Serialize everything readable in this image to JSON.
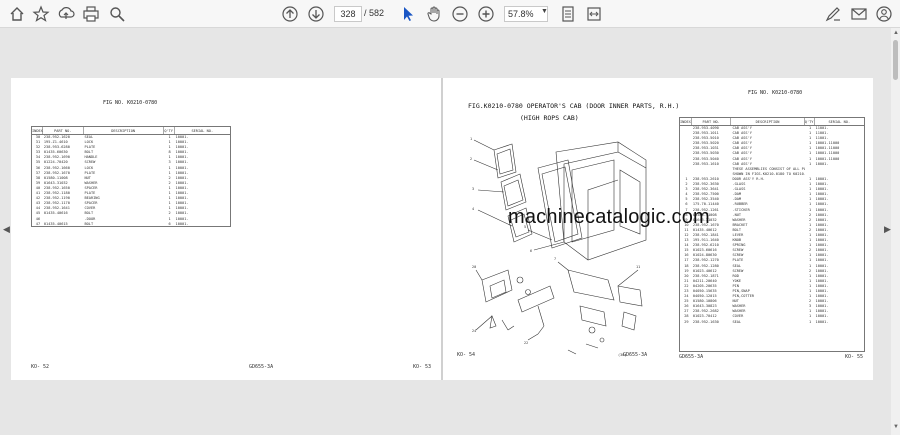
{
  "toolbar": {
    "page_current": "328",
    "page_total": "/ 582",
    "zoom": "57.8%",
    "icons": [
      "home-icon",
      "bookmark-star-icon",
      "upload-icon",
      "print-icon",
      "zoom-search-icon",
      "page-up-icon",
      "page-down-icon",
      "pointer-icon",
      "hand-icon",
      "zoom-out-icon",
      "zoom-in-icon",
      "page-fit-icon",
      "comment-icon",
      "sign-icon",
      "email-icon",
      "account-icon"
    ]
  },
  "watermark": "machinecatalogic.com",
  "left_page": {
    "fig_no": "FIG NO.  K0210-0780",
    "table_headers": [
      "INDEX",
      "PART NO.",
      "DESCRIPTION",
      "Q'TY",
      "SERIAL NO."
    ],
    "rows": [
      [
        "30",
        "238-952-1620",
        "SEAL",
        "1",
        "10001-"
      ],
      [
        "31",
        "195-Z1-4610",
        "LOCK",
        "1",
        "10001-"
      ],
      [
        "32",
        "238-953-6280",
        "PLATE",
        "1",
        "10001-"
      ],
      [
        "33",
        "01435-60630",
        "BOLT",
        "8",
        "10001-"
      ],
      [
        "34",
        "238-952-1690",
        "HANDLE",
        "1",
        "10001-"
      ],
      [
        "35",
        "01224-70420",
        "SCREW",
        "3",
        "10001-"
      ],
      [
        "36",
        "238-952-1660",
        "LOCK",
        "1",
        "10001-"
      ],
      [
        "37",
        "238-952-1670",
        "PLATE",
        "1",
        "10001-"
      ],
      [
        "38",
        "01580-11008",
        "NUT",
        "2",
        "10001-"
      ],
      [
        "39",
        "01643-31032",
        "WASHER",
        "2",
        "10001-"
      ],
      [
        "40",
        "238-952-1650",
        "SPACER",
        "1",
        "10001-"
      ],
      [
        "41",
        "238-952-1180",
        "PLATE",
        "1",
        "10001-"
      ],
      [
        "42",
        "238-952-1190",
        "BEARING",
        "1",
        "10001-"
      ],
      [
        "43",
        "238-952-1170",
        "SPACER",
        "1",
        "10001-"
      ],
      [
        "44",
        "238-952-1641",
        "COVER",
        "1",
        "10001-"
      ],
      [
        "45",
        "01435-40616",
        "BOLT",
        "2",
        "10001-"
      ],
      [
        "46",
        "",
        ".DOOR",
        "1",
        "10001-"
      ],
      [
        "47",
        "01435-40615",
        "BOLT",
        "6",
        "10001-"
      ]
    ],
    "footer_left": "KO-  52",
    "footer_mid": "GD655-3A",
    "footer_right": "KO-  53"
  },
  "right_page": {
    "fig_title": "FIG.K0210-0780  OPERATOR'S CAB (DOOR INNER PARTS, R.H.)",
    "fig_subtitle": "(HIGH ROPS CAB)",
    "fig_no": "FIG NO.  K0210-0780",
    "table_headers": [
      "INDEX",
      "PART NO.",
      "DESCRIPTION",
      "Q'TY",
      "SERIAL NO."
    ],
    "rows": [
      [
        "",
        "238-953-4090",
        "CAB ASS'Y",
        "1",
        "11001-"
      ],
      [
        "",
        "238-953-1011",
        "CAB ASS'Y",
        "1",
        "11001-"
      ],
      [
        "",
        "238-953-5010",
        "CAB ASS'Y",
        "1",
        "11001-"
      ],
      [
        "",
        "238-953-5020",
        "CAB ASS'Y",
        "1",
        "10001-11000"
      ],
      [
        "",
        "238-953-1031",
        "CAB ASS'Y",
        "1",
        "10001-11000"
      ],
      [
        "",
        "238-953-5030",
        "CAB ASS'Y",
        "1",
        "10001-11000"
      ],
      [
        "",
        "238-953-5040",
        "CAB ASS'Y",
        "1",
        "10001-11000"
      ],
      [
        "",
        "238-953-1610",
        "CAB ASS'Y",
        "1",
        "10001-"
      ],
      [
        "",
        "",
        "THESE ASSEMBLIES CONSIST OF ALL PARTS",
        "",
        ""
      ],
      [
        "",
        "",
        "SHOWN IN FIGS.K0210-0180 TO K0210-178A",
        "",
        ""
      ],
      [
        "1",
        "238-953-2610",
        "DOOR ASS'Y R.H.",
        "1",
        "10001-"
      ],
      [
        "2",
        "238-952-3630",
        ".GLASS",
        "1",
        "10001-"
      ],
      [
        "3",
        "238-952-3641",
        ".GLASS",
        "1",
        "10001-"
      ],
      [
        "4",
        "238-952-7500",
        ".DAM",
        "1",
        "10001-"
      ],
      [
        "5",
        "238-952-3540",
        ".DAM",
        "1",
        "10001-"
      ],
      [
        "6",
        "175-70-11440",
        ".RUBBER",
        "1",
        "10001-"
      ],
      [
        "7",
        "238-952-1261",
        ".STICKER",
        "1",
        "10001-"
      ],
      [
        "8",
        "01580-11008",
        ".NUT",
        "2",
        "10001-"
      ],
      [
        "9",
        "01643-31032",
        "WASHER",
        "2",
        "10001-"
      ],
      [
        "10",
        "238-952-1670",
        "BRACKET",
        "1",
        "10001-"
      ],
      [
        "11",
        "01435-40612",
        "BOLT",
        "2",
        "10001-"
      ],
      [
        "12",
        "238-952-1841",
        "LEVER",
        "1",
        "10001-"
      ],
      [
        "13",
        "195-911-1640",
        "KNOB",
        "1",
        "10001-"
      ],
      [
        "14",
        "238-952-6210",
        "SPRING",
        "1",
        "10001-"
      ],
      [
        "15",
        "01023-60616",
        "SCREW",
        "2",
        "10001-"
      ],
      [
        "16",
        "01024-80630",
        "SCREW",
        "1",
        "10001-"
      ],
      [
        "17",
        "238-952-1270",
        "PLATE",
        "1",
        "10001-"
      ],
      [
        "18",
        "238-952-1280",
        "SEAL",
        "1",
        "10001-"
      ],
      [
        "19",
        "01023-40612",
        "SCREW",
        "2",
        "10001-"
      ],
      [
        "20",
        "238-952-1871",
        "ROD",
        "1",
        "10001-"
      ],
      [
        "21",
        "04211-20640",
        "YOKE",
        "1",
        "10001-"
      ],
      [
        "22",
        "04205-20635",
        "PIN",
        "1",
        "10001-"
      ],
      [
        "23",
        "04050-15635",
        "PIN,SNAP",
        "1",
        "10001-"
      ],
      [
        "24",
        "04050-12015",
        "PIN,COTTER",
        "1",
        "10001-"
      ],
      [
        "25",
        "01580-10806",
        "NUT",
        "2",
        "10001-"
      ],
      [
        "26",
        "01643-30823",
        "WASHER",
        "3",
        "10001-"
      ],
      [
        "27",
        "238-952-2682",
        "WASHER",
        "1",
        "10001-"
      ],
      [
        "28",
        "01023-70412",
        "COVER",
        "1",
        "10001-"
      ],
      [
        "29",
        "238-952-1630",
        "SEAL",
        "1",
        "10001-"
      ]
    ],
    "footer_left": "KO-  54",
    "footer_mid": "GD655-3A",
    "footer_mid2": "GD655-3A",
    "footer_right": "KO-  55"
  }
}
